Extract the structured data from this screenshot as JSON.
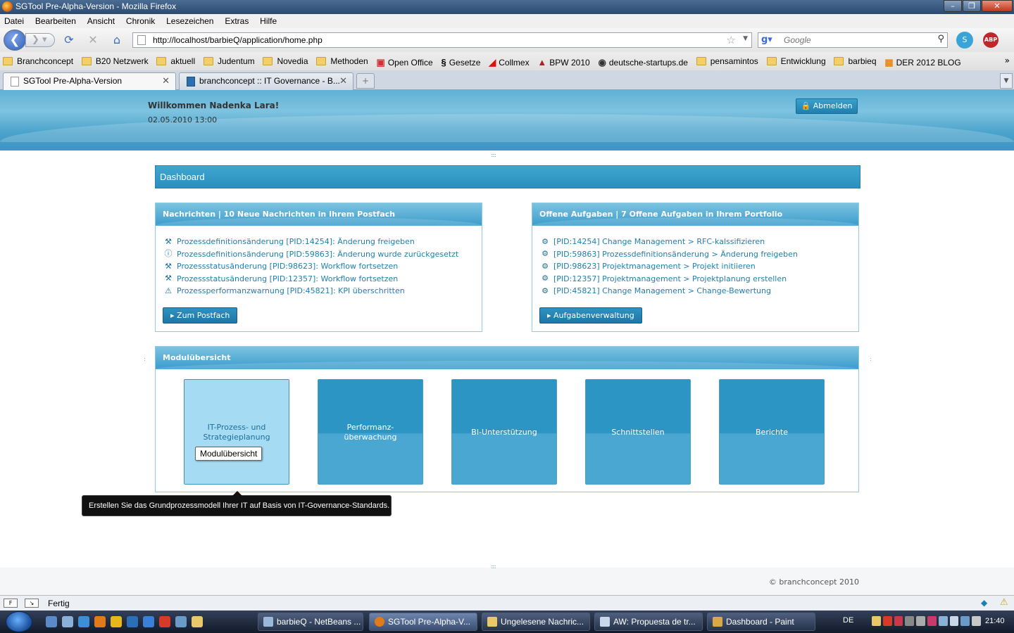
{
  "window": {
    "title": "SGTool Pre-Alpha-Version - Mozilla Firefox"
  },
  "menu": [
    "Datei",
    "Bearbeiten",
    "Ansicht",
    "Chronik",
    "Lesezeichen",
    "Extras",
    "Hilfe"
  ],
  "nav": {
    "url": "http://localhost/barbieQ/application/home.php",
    "search_placeholder": "Google"
  },
  "bookmarks": [
    {
      "label": "Branchconcept",
      "icon": "folder-icon"
    },
    {
      "label": "B20 Netzwerk",
      "icon": "folder-icon"
    },
    {
      "label": "aktuell",
      "icon": "folder-icon"
    },
    {
      "label": "Judentum",
      "icon": "folder-icon"
    },
    {
      "label": "Novedia",
      "icon": "folder-icon"
    },
    {
      "label": "Methoden",
      "icon": "folder-icon"
    },
    {
      "label": "Open Office",
      "icon": "openoffice-icon"
    },
    {
      "label": "Gesetze",
      "icon": "paragraph-icon"
    },
    {
      "label": "Collmex",
      "icon": "collmex-icon"
    },
    {
      "label": "BPW 2010",
      "icon": "bpw-icon"
    },
    {
      "label": "deutsche-startups.de",
      "icon": "ds-icon"
    },
    {
      "label": "pensamintos",
      "icon": "folder-icon"
    },
    {
      "label": "Entwicklung",
      "icon": "folder-icon"
    },
    {
      "label": "barbieq",
      "icon": "folder-icon"
    },
    {
      "label": "DER 2012 BLOG",
      "icon": "rss-icon"
    }
  ],
  "tabs": [
    {
      "label": "SGTool Pre-Alpha-Version",
      "active": true
    },
    {
      "label": "branchconcept :: IT Governance - B...",
      "active": false
    }
  ],
  "header": {
    "welcome": "Willkommen Nadenka Lara!",
    "datetime": "02.05.2010 13:00",
    "logout_label": "Abmelden"
  },
  "dashboard": {
    "title": "Dashboard"
  },
  "messages": {
    "title": "Nachrichten | 10 Neue Nachrichten in Ihrem Postfach",
    "items": [
      {
        "text": "Prozessdefinitionsänderung [PID:14254]: Änderung freigeben",
        "icon": "wrench-icon"
      },
      {
        "text": "Prozessdefinitionsänderung [PID:59863]: Änderung wurde zurückgesetzt",
        "icon": "info-icon"
      },
      {
        "text": "Prozessstatusänderung [PID:98623]: Workflow fortsetzen",
        "icon": "wrench-icon"
      },
      {
        "text": "Prozessstatusänderung [PID:12357]: Workflow fortsetzen",
        "icon": "wrench-icon"
      },
      {
        "text": "Prozessperformanzwarnung [PID:45821]: KPI überschritten",
        "icon": "warning-icon"
      }
    ],
    "button_label": "Zum Postfach"
  },
  "tasks": {
    "title": "Offene Aufgaben | 7 Offene Aufgaben in Ihrem Portfolio",
    "items": [
      {
        "text": "[PID:14254] Change Management > RFC-kalssifizieren",
        "icon": "gear-icon"
      },
      {
        "text": "[PID:59863] Prozessdefinitionsänderung > Änderung freigeben",
        "icon": "gear-icon"
      },
      {
        "text": "[PID:98623] Projektmanagement > Projekt initiieren",
        "icon": "gear-icon"
      },
      {
        "text": "[PID:12357] Projektmanagement > Projektplanung erstellen",
        "icon": "gear-icon"
      },
      {
        "text": "[PID:45821] Change Management > Change-Bewertung",
        "icon": "gear-icon"
      }
    ],
    "button_label": "Aufgabenverwaltung"
  },
  "modules": {
    "title": "Modulübersicht",
    "tiles": [
      {
        "line1": "IT-Prozess- und",
        "line2": "Strategieplanung",
        "active": true
      },
      {
        "line1": "Performanz-",
        "line2": "überwachung",
        "active": false
      },
      {
        "line1": "BI-Unterstützung",
        "line2": "",
        "active": false
      },
      {
        "line1": "Schnittstellen",
        "line2": "",
        "active": false
      },
      {
        "line1": "Berichte",
        "line2": "",
        "active": false
      }
    ],
    "tile_tip": "Modulübersicht",
    "tooltip": "Erstellen Sie das Grundprozessmodell Ihrer IT auf Basis von IT-Governance-Standards."
  },
  "footer": {
    "copyright": "© branchconcept 2010"
  },
  "statusbar": {
    "text": "Fertig"
  },
  "taskbar": {
    "items": [
      {
        "label": "barbieQ - NetBeans ...",
        "active": false
      },
      {
        "label": "SGTool Pre-Alpha-V...",
        "active": true
      },
      {
        "label": "Ungelesene Nachric...",
        "active": false
      },
      {
        "label": "AW: Propuesta de tr...",
        "active": false
      },
      {
        "label": "Dashboard - Paint",
        "active": false
      }
    ],
    "language": "DE",
    "clock": "21:40"
  },
  "colors": {
    "accent": "#2a8fbe",
    "link": "#1f7fae",
    "tile": "#2d95c3",
    "tile_active": "#a6dcf3"
  }
}
